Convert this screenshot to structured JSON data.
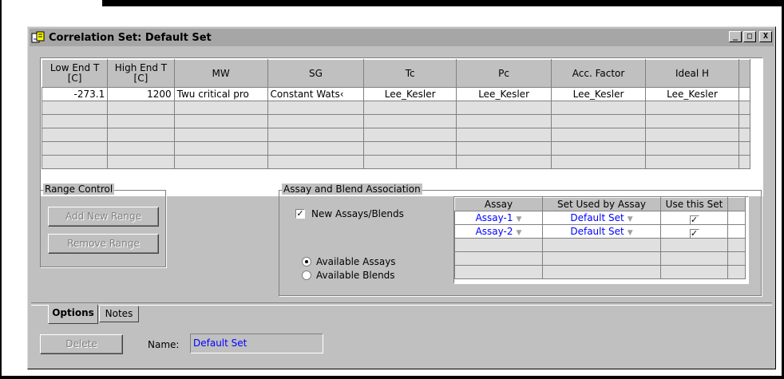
{
  "window": {
    "title": "Correlation Set: Default Set",
    "controls": {
      "minimize": "_",
      "maximize": "□",
      "close": "X"
    }
  },
  "grid": {
    "headers": [
      [
        "Low End T",
        "[C]"
      ],
      [
        "High End T",
        "[C]"
      ],
      [
        "MW"
      ],
      [
        "SG"
      ],
      [
        "Tc"
      ],
      [
        "Pc"
      ],
      [
        "Acc. Factor"
      ],
      [
        "Ideal H"
      ]
    ],
    "rows": [
      [
        "-273.1",
        "1200",
        "Twu critical pro",
        "Constant Wats‹",
        "Lee_Kesler",
        "Lee_Kesler",
        "Lee_Kesler",
        "Lee_Kesler"
      ]
    ],
    "empty_rows": 5
  },
  "range_control": {
    "label": "Range Control",
    "add_button": "Add New Range",
    "remove_button": "Remove Range"
  },
  "assay_blend": {
    "label": "Assay and Blend Association",
    "new_checkbox_label": "New Assays/Blends",
    "new_checkbox_checked": true,
    "radio_assays": "Available Assays",
    "radio_blends": "Available Blends",
    "radio_selected": "assays",
    "table": {
      "headers": [
        "Assay",
        "Set Used by Assay",
        "Use this Set"
      ],
      "rows": [
        {
          "assay": "Assay-1",
          "set": "Default Set",
          "use": true
        },
        {
          "assay": "Assay-2",
          "set": "Default Set",
          "use": true
        }
      ],
      "empty_rows": 3
    }
  },
  "tabs": [
    {
      "label": "Options",
      "active": true
    },
    {
      "label": "Notes",
      "active": false
    }
  ],
  "footer": {
    "delete_button": "Delete",
    "name_label": "Name:",
    "name_value": "Default Set"
  }
}
